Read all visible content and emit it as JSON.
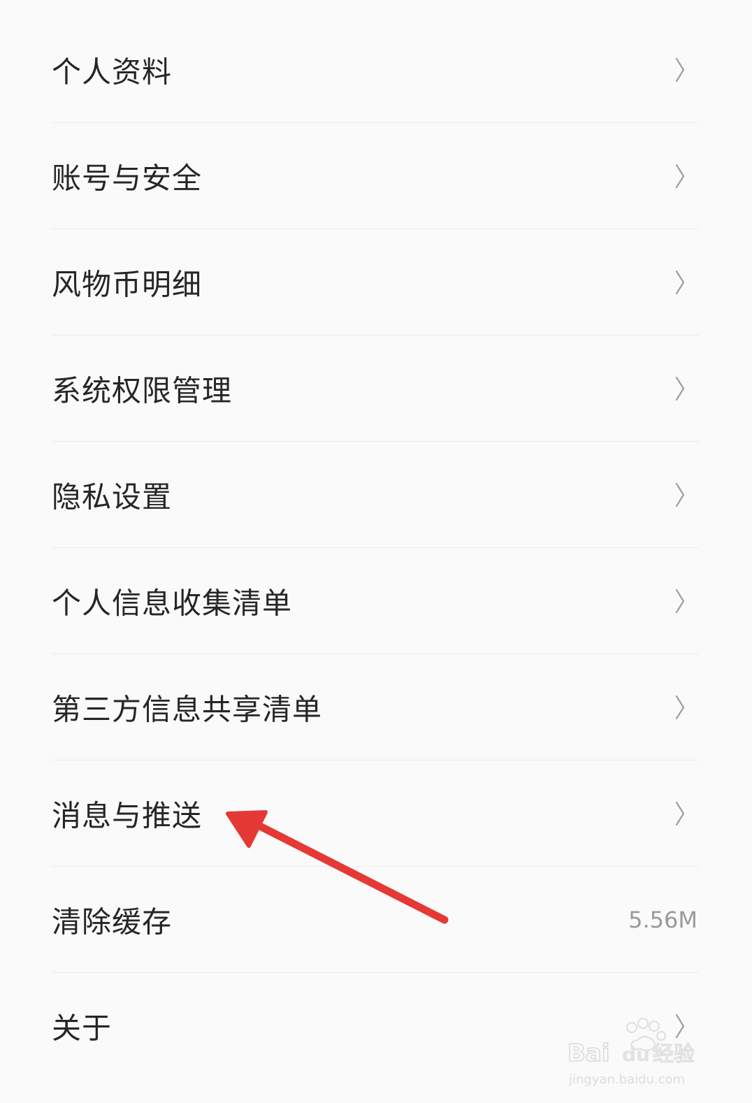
{
  "settings": {
    "items": [
      {
        "label": "个人资料",
        "has_chevron": true
      },
      {
        "label": "账号与安全",
        "has_chevron": true
      },
      {
        "label": "风物币明细",
        "has_chevron": true
      },
      {
        "label": "系统权限管理",
        "has_chevron": true
      },
      {
        "label": "隐私设置",
        "has_chevron": true
      },
      {
        "label": "个人信息收集清单",
        "has_chevron": true
      },
      {
        "label": "第三方信息共享清单",
        "has_chevron": true
      },
      {
        "label": "消息与推送",
        "has_chevron": true
      },
      {
        "label": "清除缓存",
        "value": "5.56M"
      },
      {
        "label": "关于",
        "has_chevron": true
      }
    ],
    "chevron_icon": "chevron-right-icon"
  },
  "annotation": {
    "arrow_color": "#e53935",
    "target": "消息与推送"
  },
  "watermark": {
    "brand": "Bai du 经验",
    "url": "jingyan.baidu.com"
  },
  "colors": {
    "background": "#fafafa",
    "text": "#262626",
    "secondary_text": "#9a9a9a",
    "divider": "#ececec",
    "chevron": "#9e9e9e"
  }
}
